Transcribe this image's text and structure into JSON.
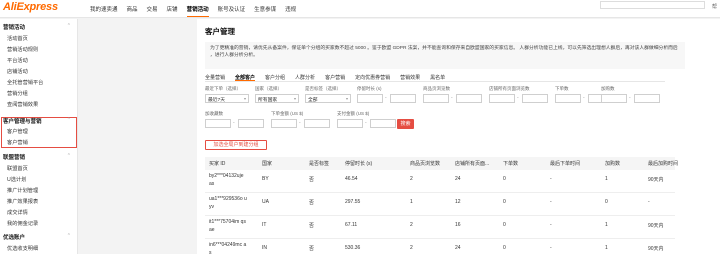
{
  "brand": {
    "logo": "AliExpress"
  },
  "topnav": [
    {
      "label": "我的速卖通"
    },
    {
      "label": "商品"
    },
    {
      "label": "交易"
    },
    {
      "label": "店铺"
    },
    {
      "label": "营销活动"
    },
    {
      "label": "账号及认证"
    },
    {
      "label": "生意参谋"
    },
    {
      "label": "违规"
    }
  ],
  "top_user": "帮",
  "sidebar": {
    "groups": [
      {
        "label": "营销活动",
        "items": [
          "活动首页",
          "营销活动规则",
          "平台活动",
          "店铺活动",
          "全托管营销平台",
          "营销分组",
          "查阅营销效果"
        ]
      },
      {
        "label": "客户管理与营销",
        "items": [
          "客户管理",
          "客户营销"
        ]
      },
      {
        "label": "联盟营销",
        "items": [
          "联盟首页",
          "U选计划",
          "推广计划管理",
          "推广效果报表",
          "成交详情",
          "我的佣金记录"
        ]
      },
      {
        "label": "优选账户",
        "items": [
          "优选收支明细"
        ]
      }
    ]
  },
  "main": {
    "title": "客户管理",
    "notice": "为了更精准的营销，请优先从备案件，保证单个分组的买家数不超过 5000 。鉴于欧盟 GDPR 法案，并不能查询和保存来自欧盟国家的买家信息。 人群分析功能已上线，可以先筛选出理想人群后，再对该人群做细分析而后 ，进行人群分析分析。",
    "tabs": [
      "全量营销",
      "全部客户",
      "客户分组",
      "人群分析",
      "客户营销",
      "定向优惠券营销",
      "营销效果",
      "黑名单"
    ],
    "active_tab_index": 1,
    "filters": {
      "row1": [
        {
          "label": "最近下单（选择）",
          "value": "最近7天"
        },
        {
          "label": "国家（选择）",
          "value": "所有国家"
        },
        {
          "label": "是否标签（选择）",
          "value": "全部"
        },
        {
          "label": "停留时长 (s)",
          "value": ""
        },
        {
          "label": "商品页浏览数",
          "value": ""
        },
        {
          "label": "店铺所有页面浏览数",
          "value": ""
        },
        {
          "label": "下单数",
          "value": ""
        },
        {
          "label": "加购数",
          "value": ""
        }
      ],
      "row2": [
        {
          "label": "加收藏数",
          "value": ""
        },
        {
          "label": "下单金额 (US $)",
          "value": ""
        },
        {
          "label": "支付金额 (US $)",
          "value": ""
        }
      ],
      "search_label": "搜索"
    },
    "add_group_button": "加选全局户到建分组",
    "table": {
      "columns": [
        "买家 ID",
        "国家",
        "是否标签",
        "停留时长 (s)",
        "商品页浏览数",
        "店铺所有页面...",
        "下单数",
        "最后下单时间",
        "加购数",
        "最后加购时间"
      ],
      "rows": [
        [
          "by2***04132uje as",
          "BY",
          "否",
          "46.54",
          "2",
          "24",
          "0",
          "-",
          "1",
          "90天内"
        ],
        [
          "ua1***929536o uyv",
          "UA",
          "否",
          "297.55",
          "1",
          "12",
          "0",
          "-",
          "0",
          "-"
        ],
        [
          "it1***75704im qsae",
          "IT",
          "否",
          "67.11",
          "2",
          "16",
          "0",
          "-",
          "1",
          "90天内"
        ],
        [
          "in6***04249mc as",
          "IN",
          "否",
          "530.36",
          "2",
          "24",
          "0",
          "-",
          "1",
          "90天内"
        ]
      ]
    }
  }
}
